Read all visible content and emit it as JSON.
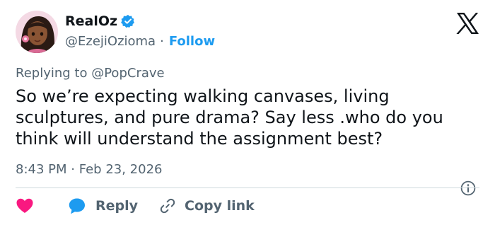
{
  "user": {
    "display_name": "RealOz",
    "handle": "@EzejiOzioma",
    "separator": "·",
    "follow_label": "Follow",
    "verified": true
  },
  "reply_context": {
    "prefix": "Replying to",
    "handle": "@PopCrave"
  },
  "tweet": {
    "text": "So we’re expecting walking canvases, living sculptures, and pure drama? Say less .who do you think will understand the assignment best?",
    "time": "8:43 PM",
    "separator": "·",
    "date": "Feb 23, 2026"
  },
  "actions": {
    "reply_label": "Reply",
    "copy_label": "Copy link"
  },
  "icons": {
    "avatar": "avatar-image",
    "verified": "verified-badge-icon",
    "logo": "x-logo-icon",
    "info": "info-icon",
    "heart": "heart-icon",
    "reply": "reply-bubble-icon",
    "link": "link-icon"
  },
  "colors": {
    "accent": "#1d9bf0",
    "text": "#0f1419",
    "muted": "#536471",
    "heart": "#f91880",
    "divider": "#cfd9de"
  }
}
